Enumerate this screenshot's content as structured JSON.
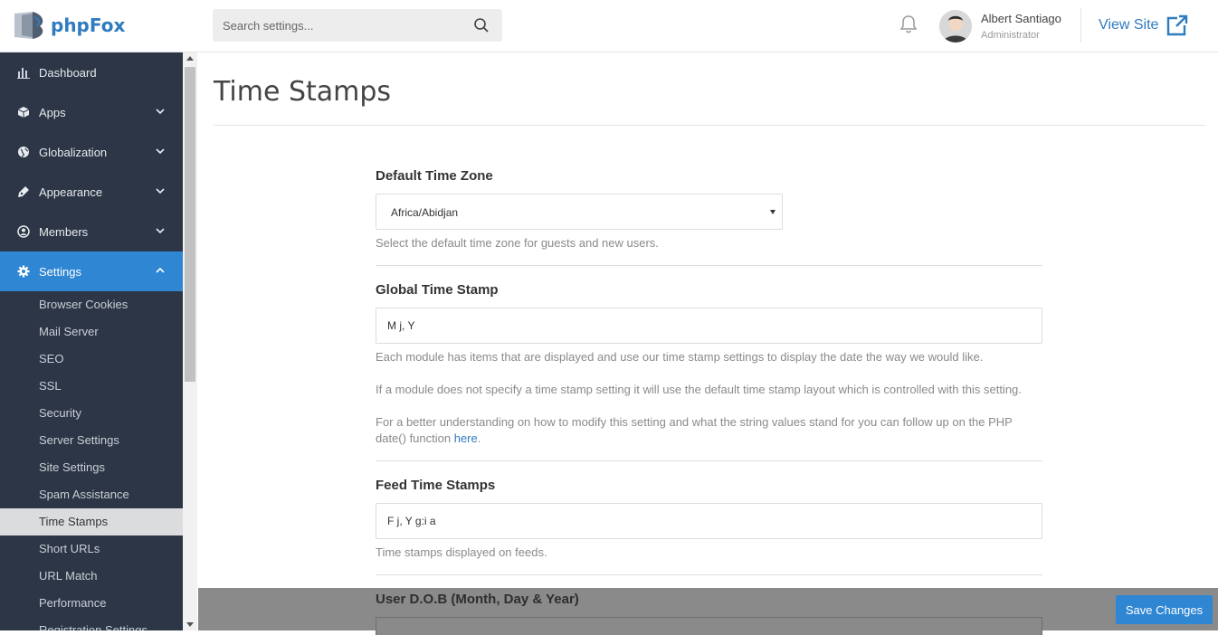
{
  "header": {
    "brand": "phpFox",
    "search_placeholder": "Search settings...",
    "user_name": "Albert Santiago",
    "user_role": "Administrator",
    "view_site_label": "View Site"
  },
  "sidebar": {
    "items": [
      {
        "label": "Dashboard",
        "icon": "bar-chart-icon"
      },
      {
        "label": "Apps",
        "icon": "cube-icon"
      },
      {
        "label": "Globalization",
        "icon": "globe-icon"
      },
      {
        "label": "Appearance",
        "icon": "pen-icon"
      },
      {
        "label": "Members",
        "icon": "user-circle-icon"
      },
      {
        "label": "Settings",
        "icon": "gear-icon"
      }
    ],
    "sub_items": [
      "Browser Cookies",
      "Mail Server",
      "SEO",
      "SSL",
      "Security",
      "Server Settings",
      "Site Settings",
      "Spam Assistance",
      "Time Stamps",
      "Short URLs",
      "URL Match",
      "Performance",
      "Registration Settings"
    ],
    "active_item": "Settings",
    "current_sub_item": "Time Stamps"
  },
  "main": {
    "page_title": "Time Stamps",
    "default_time_zone": {
      "label": "Default Time Zone",
      "value": "Africa/Abidjan",
      "help": "Select the default time zone for guests and new users."
    },
    "global_time_stamp": {
      "label": "Global Time Stamp",
      "value": "M j, Y",
      "help_1": "Each module has items that are displayed and use our time stamp settings to display the date the way we would like.",
      "help_2": "If a module does not specify a time stamp setting it will use the default time stamp layout which is controlled with this setting.",
      "help_3": "For a better understanding on how to modify this setting and what the string values stand for you can follow up on the PHP date() function ",
      "help_link": "here",
      "help_end": "."
    },
    "feed_time_stamps": {
      "label": "Feed Time Stamps",
      "value": "F j, Y g:i a",
      "help": "Time stamps displayed on feeds."
    },
    "user_dob": {
      "label": "User D.O.B (Month, Day & Year)"
    }
  },
  "footer": {
    "save_label": "Save Changes"
  },
  "colors": {
    "accent": "#2f86d3",
    "sidebar_bg": "#2c3646",
    "link": "#2f7bbf"
  }
}
